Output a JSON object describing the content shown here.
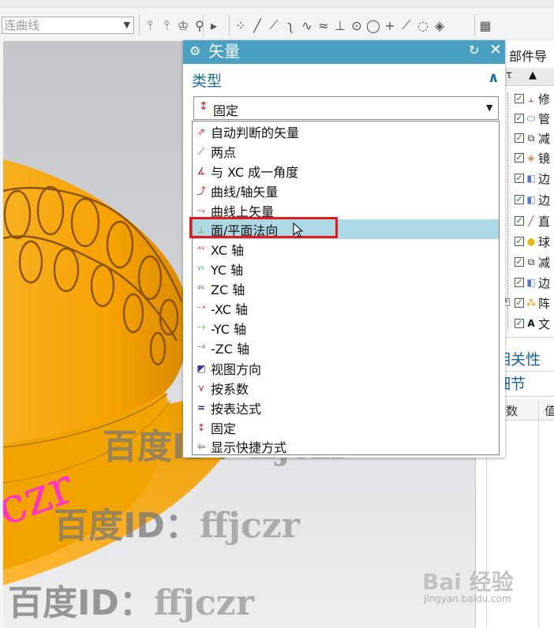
{
  "toolbar": {
    "curve_select_value": "连曲线",
    "icons": [
      "curve-icon-a",
      "curve-icon-b",
      "sketch-icon",
      "offset-icon",
      "arrow-right-icon",
      "point-set-icon",
      "line-icon",
      "line-diag-icon",
      "arc-icon",
      "spline-icon",
      "wave-icon",
      "perpendicular-icon",
      "circle-point-icon",
      "circle-icon",
      "plus-icon",
      "slash-icon",
      "spiral-icon",
      "layer-icon",
      "grid-icon"
    ]
  },
  "dialog": {
    "title": "矢量",
    "type_label": "类型",
    "type_value": "固定",
    "colors": {
      "title_bar": "#4aa0c2",
      "accent_text": "#1b6fa1",
      "selected_row": "#add8e6",
      "highlight_border": "#e11b1b"
    },
    "options": [
      {
        "label": "自动判断的矢量",
        "icon": "inferred-vector-icon",
        "selected": false
      },
      {
        "label": "两点",
        "icon": "two-points-icon",
        "selected": false
      },
      {
        "label": "与 XC 成一角度",
        "icon": "angle-xc-icon",
        "selected": false
      },
      {
        "label": "曲线/轴矢量",
        "icon": "curve-axis-icon",
        "selected": false
      },
      {
        "label": "曲线上矢量",
        "icon": "vector-on-curve-icon",
        "selected": false
      },
      {
        "label": "面/平面法向",
        "icon": "face-normal-icon",
        "selected": true
      },
      {
        "label": "XC 轴",
        "icon": "xc-axis-icon",
        "selected": false
      },
      {
        "label": "YC 轴",
        "icon": "yc-axis-icon",
        "selected": false
      },
      {
        "label": "ZC 轴",
        "icon": "zc-axis-icon",
        "selected": false
      },
      {
        "label": "-XC 轴",
        "icon": "neg-xc-axis-icon",
        "selected": false
      },
      {
        "label": "-YC 轴",
        "icon": "neg-yc-axis-icon",
        "selected": false
      },
      {
        "label": "-ZC 轴",
        "icon": "neg-zc-axis-icon",
        "selected": false
      },
      {
        "label": "视图方向",
        "icon": "view-direction-icon",
        "selected": false
      },
      {
        "label": "按系数",
        "icon": "by-coefficients-icon",
        "selected": false
      },
      {
        "label": "按表达式",
        "icon": "by-expression-icon",
        "selected": false
      },
      {
        "label": "固定",
        "icon": "fixed-icon",
        "selected": false
      },
      {
        "label": "显示快捷方式",
        "icon": "show-shortcuts-icon",
        "selected": false
      }
    ]
  },
  "navigator": {
    "title": "部件导航",
    "header_col": "τ",
    "rows": [
      {
        "icon": "feature-icon",
        "text": "修"
      },
      {
        "icon": "tube-icon",
        "text": "管"
      },
      {
        "icon": "subtract-icon",
        "text": "减"
      },
      {
        "icon": "mirror-icon",
        "text": "镜"
      },
      {
        "icon": "edge-icon",
        "text": "边"
      },
      {
        "icon": "edge-icon",
        "text": "边"
      },
      {
        "icon": "line-icon",
        "text": "直"
      },
      {
        "icon": "sphere-icon",
        "text": "球"
      },
      {
        "icon": "subtract-icon",
        "text": "减"
      },
      {
        "icon": "edge-icon",
        "text": "边"
      },
      {
        "icon": "array-icon",
        "text": "阵"
      },
      {
        "icon": "text-icon",
        "text": "文"
      }
    ],
    "dependencies_label": "相关性",
    "details_label": "细节",
    "params_col": "参数",
    "value_col": "值"
  },
  "viewport": {
    "ring_text": "czr",
    "ring_color": "#f2a000",
    "ring_text_color": "#ff33cc"
  },
  "watermarks": [
    {
      "zh": "百度ID：",
      "en": "ffjczr"
    },
    {
      "zh": "百度ID：",
      "en": "ffjczr"
    },
    {
      "zh": "百度ID：",
      "en": "ffjczr"
    }
  ],
  "baidu": {
    "logo": "Bai 经验",
    "sub": "jingyan.baidu.com"
  }
}
